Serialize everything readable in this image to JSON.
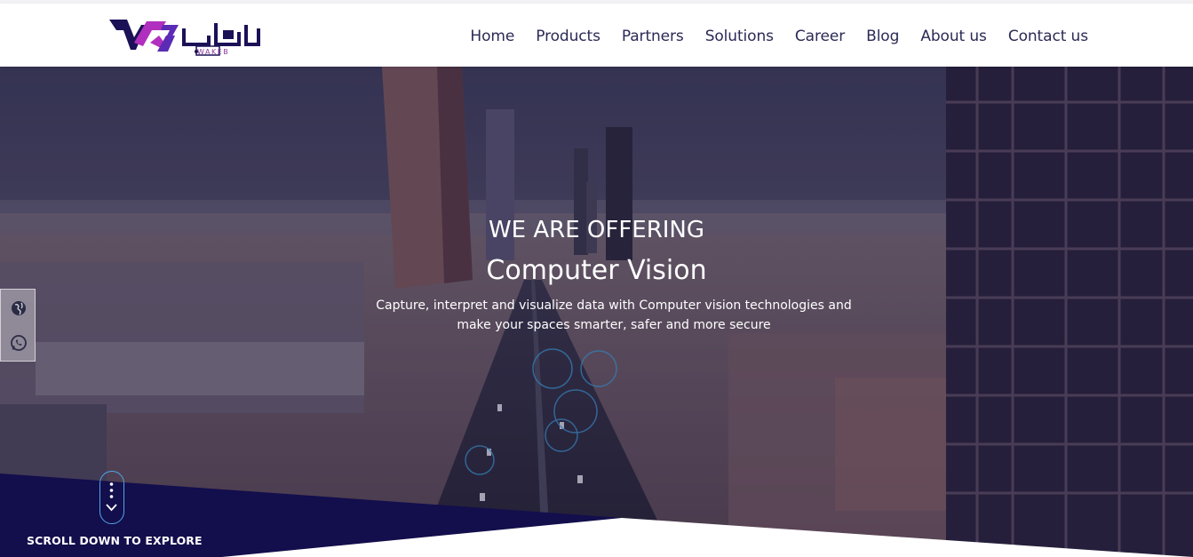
{
  "brand": {
    "logo_arabic": "واكب",
    "logo_latin": "WAKEB",
    "colors": {
      "navy": "#1b1157",
      "magenta": "#b12fbe",
      "purple": "#5c2bb5"
    }
  },
  "nav": {
    "items": [
      {
        "label": "Home"
      },
      {
        "label": "Products"
      },
      {
        "label": "Partners"
      },
      {
        "label": "Solutions"
      },
      {
        "label": "Career"
      },
      {
        "label": "Blog"
      },
      {
        "label": "About us"
      },
      {
        "label": "Contact us"
      }
    ]
  },
  "hero": {
    "subtitle": "WE ARE OFFERING",
    "title": "Computer Vision",
    "description": "Capture, interpret and visualize data with Computer vision technologies and make your spaces smarter, safer and more secure"
  },
  "side_social": {
    "icons": [
      "globe-icon",
      "whatsapp-icon"
    ]
  },
  "scroll": {
    "label": "SCROLL DOWN TO EXPLORE",
    "icon": "chevron-down-icon"
  }
}
